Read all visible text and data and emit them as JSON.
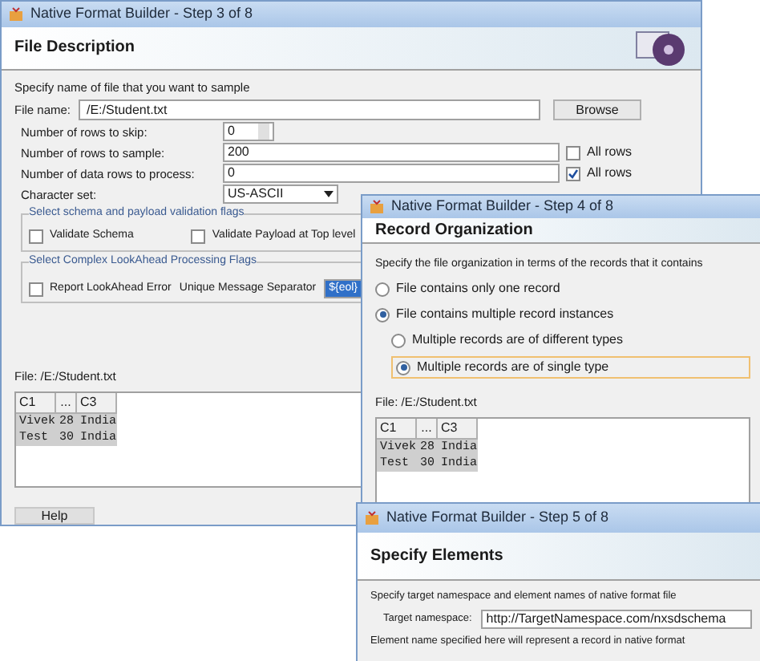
{
  "step3": {
    "title": "Native Format Builder - Step 3 of 8",
    "heading": "File Description",
    "intro": "Specify name of file that you want to sample",
    "file_label": "File name:",
    "file_value": "/E:/Student.txt",
    "browse": "Browse",
    "rows": [
      {
        "label": "Number of rows to skip:",
        "value": "0",
        "kind": "spinner"
      },
      {
        "label": "Number of rows to sample:",
        "value": "200",
        "kind": "text",
        "check_label": "All rows",
        "checked": false
      },
      {
        "label": "Number of data rows to process:",
        "value": "0",
        "kind": "text",
        "check_label": "All rows",
        "checked": true
      },
      {
        "label": "Character set:",
        "value": "US-ASCII",
        "kind": "combo"
      }
    ],
    "group1": {
      "title": "Select schema and payload validation flags",
      "options": [
        {
          "label": "Validate Schema",
          "checked": false
        },
        {
          "label": "Validate Payload at Top level",
          "checked": false
        }
      ]
    },
    "group2": {
      "title": "Select Complex LookAhead Processing Flags",
      "option": {
        "label": "Report LookAhead Error",
        "checked": false
      },
      "separator_label": "Unique Message Separator",
      "separator_value": "${eol}"
    },
    "file_line": "File: /E:/Student.txt",
    "table": {
      "columns": [
        "C1",
        "...",
        "C3"
      ],
      "rows": [
        [
          "Vivek",
          "28",
          "India"
        ],
        [
          "Test",
          "30",
          "India"
        ]
      ]
    },
    "help": "Help"
  },
  "step4": {
    "title": "Native Format Builder - Step 4 of 8",
    "heading": "Record Organization",
    "intro": "Specify the file organization in terms of the records that it contains",
    "options": [
      {
        "label": "File contains only one record",
        "selected": false
      },
      {
        "label": "File contains multiple record instances",
        "selected": true,
        "children": [
          {
            "label": "Multiple records are of different types",
            "selected": false
          },
          {
            "label": "Multiple records are of single type",
            "selected": true
          }
        ]
      }
    ],
    "file_line": "File: /E:/Student.txt",
    "table": {
      "columns": [
        "C1",
        "...",
        "C3"
      ],
      "rows": [
        [
          "Vivek",
          "28",
          "India"
        ],
        [
          "Test",
          "30",
          "India"
        ]
      ]
    }
  },
  "step5": {
    "title": "Native Format Builder - Step 5 of 8",
    "heading": "Specify Elements",
    "intro": "Specify target namespace and element names of native format file",
    "ns_label": "Target namespace:",
    "ns_value": "http://TargetNamespace.com/nxsdschema",
    "note": "Element name specified here will represent a record in native format"
  }
}
